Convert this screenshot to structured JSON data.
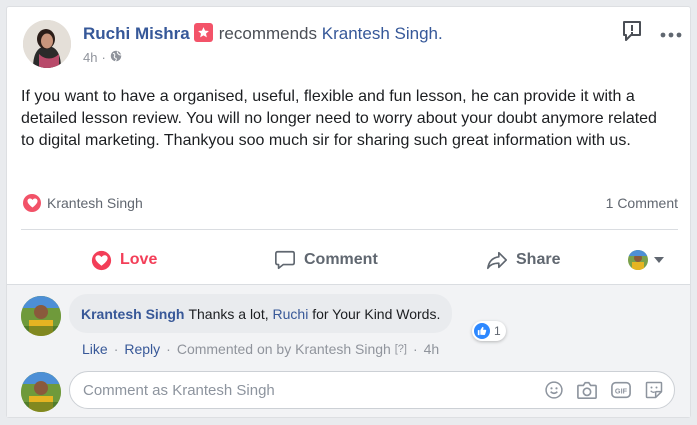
{
  "post": {
    "author": "Ruchi Mishra",
    "action_text": "recommends",
    "target": "Krantesh Singh.",
    "time": "4h",
    "body": "If you want to have a organised, useful, flexible and fun lesson, he can provide it with a detailed lesson review. You will no longer need to worry about your doubt anymore related to digital marketing. Thankyou soo much sir for sharing such great information with us."
  },
  "reactions": {
    "reactor": "Krantesh Singh",
    "comment_count": "1 Comment"
  },
  "actions": {
    "love": "Love",
    "comment": "Comment",
    "share": "Share"
  },
  "comment": {
    "author": "Krantesh Singh",
    "text_before": "Thanks a lot,",
    "mention": "Ruchi",
    "text_after": "for Your Kind Words.",
    "like_count": "1",
    "like": "Like",
    "reply": "Reply",
    "commented_on_by": "Commented on by Krantesh Singh",
    "help": "[?]",
    "time": "4h"
  },
  "composer": {
    "placeholder": "Comment as Krantesh Singh"
  },
  "colors": {
    "link": "#365899",
    "love": "#f33e58",
    "badge": "#f35369",
    "like": "#2d88ff"
  }
}
